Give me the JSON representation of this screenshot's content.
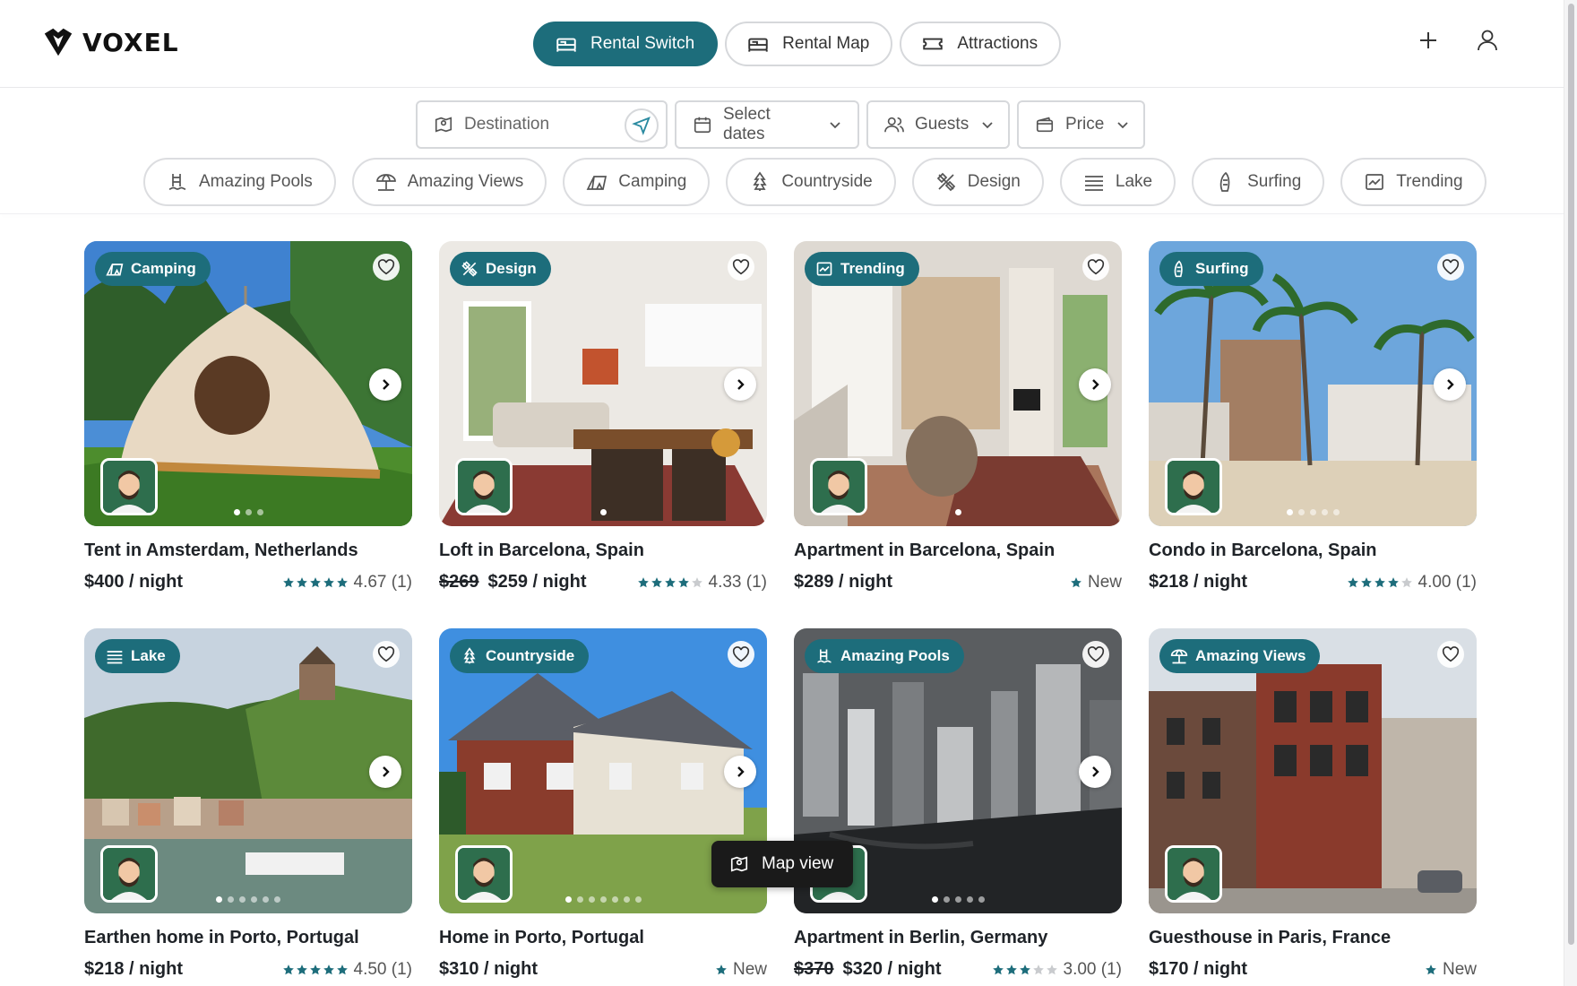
{
  "brand": {
    "name": "VOXEL"
  },
  "nav": [
    {
      "label": "Rental Switch",
      "icon": "bed-icon",
      "active": true
    },
    {
      "label": "Rental Map",
      "icon": "bed-icon",
      "active": false
    },
    {
      "label": "Attractions",
      "icon": "ticket-icon",
      "active": false
    }
  ],
  "search": {
    "destination_placeholder": "Destination",
    "dates_label": "Select dates",
    "guests_label": "Guests",
    "price_label": "Price"
  },
  "filters": [
    "Amazing Pools",
    "Amazing Views",
    "Camping",
    "Countryside",
    "Design",
    "Lake",
    "Surfing",
    "Trending"
  ],
  "listings": [
    {
      "tag": "Camping",
      "title": "Tent in Amsterdam, Netherlands",
      "old_price": "",
      "price": "$400 / night",
      "rating": "4.67 (1)",
      "stars": 4.67,
      "dots": 3,
      "active_dot": 0
    },
    {
      "tag": "Design",
      "title": "Loft in Barcelona, Spain",
      "old_price": "$269",
      "price": "$259 / night",
      "rating": "4.33 (1)",
      "stars": 4.33,
      "dots": 1,
      "active_dot": 0
    },
    {
      "tag": "Trending",
      "title": "Apartment in Barcelona, Spain",
      "old_price": "",
      "price": "$289 / night",
      "rating": "New",
      "stars": 0,
      "dots": 1,
      "active_dot": 0
    },
    {
      "tag": "Surfing",
      "title": "Condo in Barcelona, Spain",
      "old_price": "",
      "price": "$218 / night",
      "rating": "4.00 (1)",
      "stars": 4.0,
      "dots": 5,
      "active_dot": 0
    },
    {
      "tag": "Lake",
      "title": "Earthen home in Porto, Portugal",
      "old_price": "",
      "price": "$218 / night",
      "rating": "4.50 (1)",
      "stars": 4.5,
      "dots": 6,
      "active_dot": 0
    },
    {
      "tag": "Countryside",
      "title": "Home in Porto, Portugal",
      "old_price": "",
      "price": "$310 / night",
      "rating": "New",
      "stars": 0,
      "dots": 7,
      "active_dot": 0
    },
    {
      "tag": "Amazing Pools",
      "title": "Apartment in Berlin, Germany",
      "old_price": "$370",
      "price": "$320 / night",
      "rating": "3.00 (1)",
      "stars": 3.0,
      "dots": 5,
      "active_dot": 0
    },
    {
      "tag": "Amazing Views",
      "title": "Guesthouse in Paris, France",
      "old_price": "",
      "price": "$170 / night",
      "rating": "New",
      "stars": 0,
      "dots": 0,
      "active_dot": 0
    }
  ],
  "map_view": {
    "label": "Map view"
  },
  "colors": {
    "accent": "#1d6d7b",
    "text": "#1f2328",
    "border": "#d6d8db"
  }
}
